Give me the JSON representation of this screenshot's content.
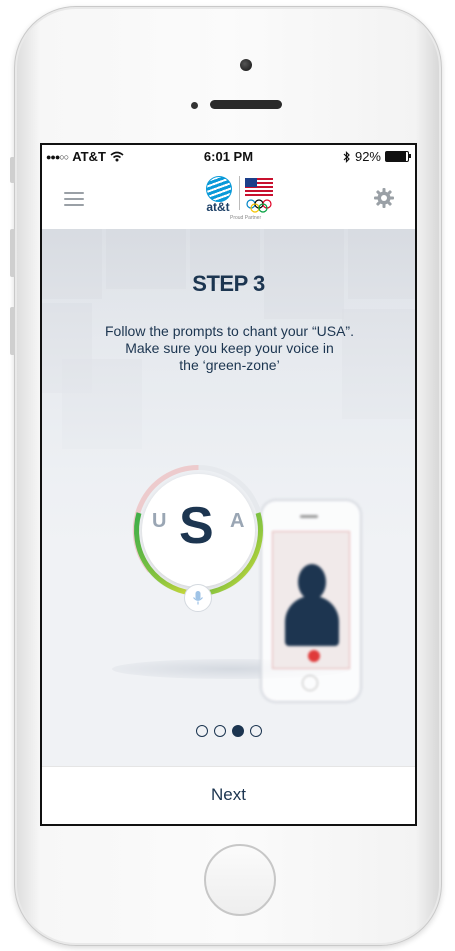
{
  "status_bar": {
    "carrier": "AT&T",
    "time": "6:01 PM",
    "battery": "92%",
    "battery_level": 0.92
  },
  "nav": {
    "logo_text": "at&t",
    "partner_text": "Proud Partner"
  },
  "content": {
    "step_title": "STEP 3",
    "instructions": [
      "Follow the prompts to chant your “USA”.",
      "Make sure you keep your voice in",
      "the ‘green-zone’"
    ],
    "gauge_letters": [
      "U",
      "S",
      "A"
    ],
    "pager": {
      "total": 4,
      "active_index": 2
    }
  },
  "footer": {
    "next_label": "Next"
  },
  "colors": {
    "primary": "#1c3550",
    "gauge_green": "#3fae49",
    "gauge_yellow": "#d7dc3a",
    "record": "#e03a3a"
  }
}
